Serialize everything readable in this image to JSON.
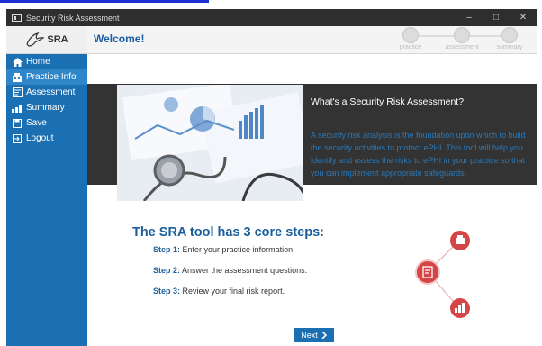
{
  "window": {
    "title": "Security Risk Assessment",
    "controls": [
      "–",
      "□",
      "✕"
    ]
  },
  "header": {
    "logo_text": "SRA",
    "welcome": "Welcome!"
  },
  "progress": {
    "steps": [
      {
        "label": "practice"
      },
      {
        "label": "assessment"
      },
      {
        "label": "summary"
      }
    ]
  },
  "sidebar": {
    "items": [
      {
        "label": "Home",
        "icon": "home-icon"
      },
      {
        "label": "Practice Info",
        "icon": "building-icon"
      },
      {
        "label": "Assessment",
        "icon": "clipboard-icon"
      },
      {
        "label": "Summary",
        "icon": "chart-icon"
      },
      {
        "label": "Save",
        "icon": "save-icon"
      },
      {
        "label": "Logout",
        "icon": "logout-icon"
      }
    ]
  },
  "main": {
    "info_title": "What's a Security Risk Assessment?",
    "info_text": "A security risk analysis is the foundation upon which to build the security activities to protect ePHI.  This tool will help you identify and assess the risks to ePHI in your practice so that you can implement appropriate safeguards.",
    "core_title": "The SRA tool has 3 core steps:",
    "steps": [
      {
        "label": "Step 1:",
        "text": "Enter your practice information."
      },
      {
        "label": "Step 2:",
        "text": "Answer the assessment questions."
      },
      {
        "label": "Step 3:",
        "text": "Review your final risk report."
      }
    ],
    "next_label": "Next"
  },
  "colors": {
    "sidebar": "#1b6fb3",
    "accent": "#1b5e9c",
    "steps_icon": "#d64545"
  }
}
